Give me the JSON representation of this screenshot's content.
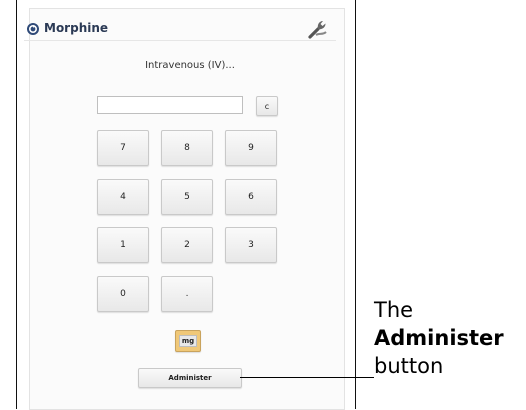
{
  "header": {
    "title": "Morphine",
    "back_icon": "circle-arrow-icon",
    "settings_icon": "wrench-icon"
  },
  "route": "Intravenous (IV)...",
  "entry": {
    "value": "",
    "clear_label": "c"
  },
  "keypad": {
    "keys": [
      "7",
      "8",
      "9",
      "4",
      "5",
      "6",
      "1",
      "2",
      "3",
      "0",
      "."
    ]
  },
  "unit_label": "mg",
  "administer_label": "Administer",
  "annotation": {
    "line1": "The",
    "line2": "Administer",
    "line3": "button"
  },
  "colors": {
    "title": "#2b3a55",
    "unit_highlight": "#f0c878"
  }
}
